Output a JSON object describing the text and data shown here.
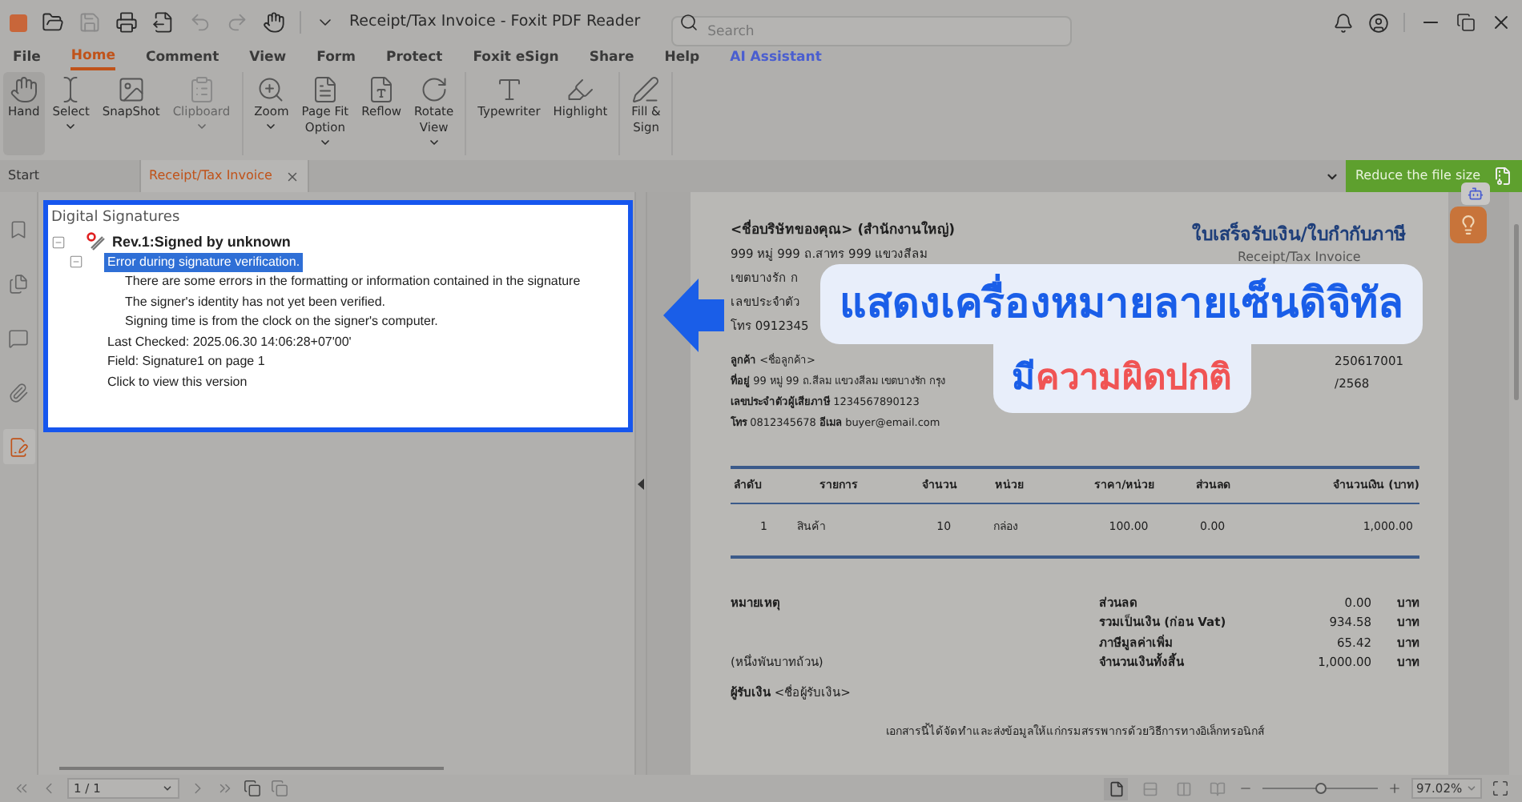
{
  "window": {
    "title": "Receipt/Tax Invoice - Foxit PDF Reader"
  },
  "search": {
    "placeholder": "Search"
  },
  "menu_tabs": [
    {
      "label": "File",
      "selected": false,
      "kind": "tab"
    },
    {
      "label": "Home",
      "selected": true,
      "kind": "tab"
    },
    {
      "label": "Comment",
      "selected": false,
      "kind": "tab"
    },
    {
      "label": "View",
      "selected": false,
      "kind": "tab"
    },
    {
      "label": "Form",
      "selected": false,
      "kind": "tab"
    },
    {
      "label": "Protect",
      "selected": false,
      "kind": "tab"
    },
    {
      "label": "Foxit eSign",
      "selected": false,
      "kind": "tab"
    },
    {
      "label": "Share",
      "selected": false,
      "kind": "tab"
    },
    {
      "label": "Help",
      "selected": false,
      "kind": "tab"
    },
    {
      "label": "AI Assistant",
      "selected": false,
      "kind": "ai"
    }
  ],
  "ribbon_groups": [
    {
      "items": [
        {
          "lines": [
            "Hand"
          ],
          "selected": true,
          "disabled": false,
          "dropdown": false
        },
        {
          "lines": [
            "Select"
          ],
          "selected": false,
          "disabled": false,
          "dropdown": true
        },
        {
          "lines": [
            "SnapShot"
          ],
          "selected": false,
          "disabled": false,
          "dropdown": false
        },
        {
          "lines": [
            "Clipboard"
          ],
          "selected": false,
          "disabled": true,
          "dropdown": true
        }
      ]
    },
    {
      "items": [
        {
          "lines": [
            "Zoom"
          ],
          "selected": false,
          "disabled": false,
          "dropdown": true
        },
        {
          "lines": [
            "Page Fit",
            "Option"
          ],
          "selected": false,
          "disabled": false,
          "dropdown": true
        },
        {
          "lines": [
            "Reflow"
          ],
          "selected": false,
          "disabled": false,
          "dropdown": false
        },
        {
          "lines": [
            "Rotate",
            "View"
          ],
          "selected": false,
          "disabled": false,
          "dropdown": true
        }
      ]
    },
    {
      "items": [
        {
          "lines": [
            "Typewriter"
          ],
          "selected": false,
          "disabled": false,
          "dropdown": false
        },
        {
          "lines": [
            "Highlight"
          ],
          "selected": false,
          "disabled": false,
          "dropdown": false
        }
      ]
    },
    {
      "items": [
        {
          "lines": [
            "Fill &",
            "Sign"
          ],
          "selected": false,
          "disabled": false,
          "dropdown": false
        }
      ]
    }
  ],
  "doc_tabs": [
    {
      "label": "Start",
      "selected": false,
      "closable": false
    },
    {
      "label": "Receipt/Tax Invoice",
      "selected": true,
      "closable": true
    }
  ],
  "reduce_button": {
    "label": "Reduce the file size"
  },
  "side_icons": [
    {
      "kind": "bookmark",
      "selected": false
    },
    {
      "kind": "pages",
      "selected": false
    },
    {
      "kind": "comments",
      "selected": false
    },
    {
      "kind": "attachments",
      "selected": false
    },
    {
      "kind": "signature",
      "selected": true
    }
  ],
  "signatures_panel": {
    "title": "Digital Signatures",
    "tree": [
      {
        "label": "Rev.1:Signed by unknown",
        "selected": false,
        "expanded": true,
        "children": [
          {
            "label": "Error during signature verification.",
            "selected": true,
            "expanded": true,
            "children": [
              {
                "label": "There are some errors in the formatting or information contained in the signature",
                "selected": false
              },
              {
                "label": "The signer's identity has not yet been verified.",
                "selected": false
              },
              {
                "label": "Signing time is from the clock on the signer's computer.",
                "selected": false
              }
            ]
          },
          {
            "label": "Last Checked: 2025.06.30 14:06:28+07'00'",
            "selected": false
          },
          {
            "label": "Field: Signature1 on page 1",
            "selected": false
          },
          {
            "label": "Click to view this version",
            "selected": false
          }
        ]
      }
    ]
  },
  "invoice": {
    "company": "<ชื่อบริษัทของคุณ> (สำนักงานใหญ่)",
    "company_lines": [
      "999 หมู่ 999 ถ.สาทร 999 แขวงสีลม",
      "เขตบางรัก ก",
      "เลขประจำตัว",
      "โทร 0912345"
    ],
    "title": "ใบเสร็จรับเงิน/ใบกำกับภาษี",
    "subtitle": "Receipt/Tax Invoice",
    "customer_lines": [
      "**ลูกค้า** <ชื่อลูกค้า>",
      "**ที่อยู่** 99 หมู่ 99 ถ.สีลม แขวงสีลม เขตบางรัก กรุง",
      "**เลขประจำตัวผู้เสียภาษี** 1234567890123",
      "**โทร** 0812345678  **อีเมล** buyer@email.com"
    ],
    "meta_lines": [
      "250617001",
      "/2568"
    ],
    "table": {
      "columns": [
        "ลำดับ",
        "รายการ",
        "จำนวน",
        "หน่วย",
        "ราคา/หน่วย",
        "ส่วนลด",
        "จำนวนเงิน (บาท)"
      ],
      "rows": [
        [
          "1",
          "สินค้า",
          "10",
          "กล่อง",
          "100.00",
          "0.00",
          "1,000.00"
        ]
      ]
    },
    "notes_label": "หมายเหตุ",
    "amount_words": "(หนึ่งพันบาทถ้วน)",
    "totals": [
      {
        "label": "ส่วนลด",
        "value": "0.00",
        "unit": "บาท"
      },
      {
        "label": "รวมเป็นเงิน (ก่อน Vat)",
        "value": "934.58",
        "unit": "บาท"
      },
      {
        "label": "ภาษีมูลค่าเพิ่ม",
        "value": "65.42",
        "unit": "บาท"
      },
      {
        "label": "จำนวนเงินทั้งสิ้น",
        "value": "1,000.00",
        "unit": "บาท"
      }
    ],
    "receiver": "**ผู้รับเงิน** <ชื่อผู้รับเงิน>",
    "footer": "เอกสารนี้ได้จัดทำและส่งข้อมูลให้แก่กรมสรรพากรด้วยวิธีการทางอิเล็กทรอนิกส์"
  },
  "callout": {
    "line1": "แสดงเครื่องหมายลายเซ็นดิจิทัล",
    "line2": [
      {
        "text": "มี",
        "color": "#1a5ee8"
      },
      {
        "text": "ความผิดปกติ",
        "color": "#f05454"
      }
    ]
  },
  "page_nav": {
    "value": "1 / 1"
  },
  "view_modes": [
    {
      "selected": true
    },
    {
      "selected": false
    },
    {
      "selected": false
    },
    {
      "selected": false
    }
  ],
  "zoom": {
    "value": "97.02%",
    "level": 0.5
  }
}
